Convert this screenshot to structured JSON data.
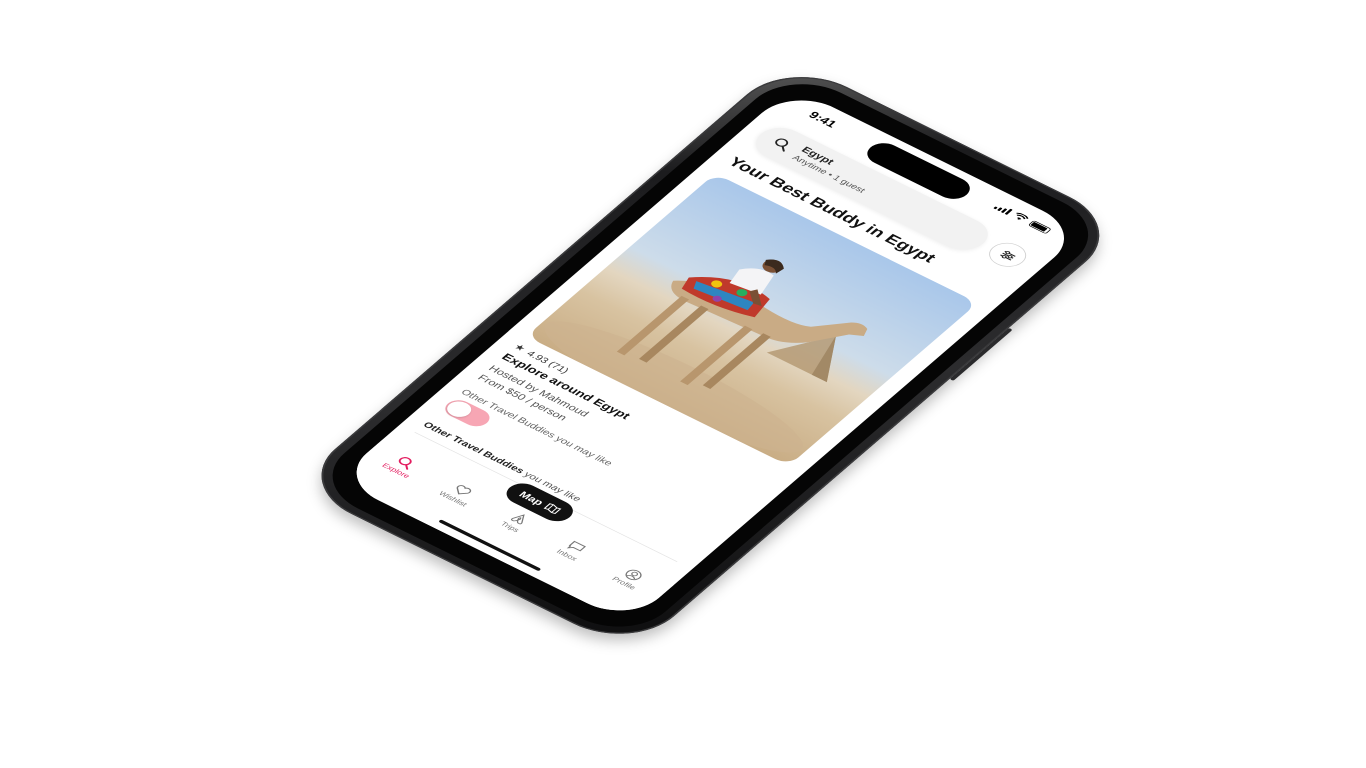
{
  "status_bar": {
    "time": "9:41"
  },
  "search": {
    "location": "Egypt",
    "details": "Anytime • 1 guest"
  },
  "section_title": "Your Best Buddy in Egypt",
  "listing": {
    "rating": "4.93 (71)",
    "title": "Explore around Egypt",
    "host": "Hosted by Mahmoud",
    "price": "From $50 / person"
  },
  "toggle": {
    "label": "Other Travel Buddies you may like",
    "label_bold": "Other Travel Buddies",
    "label_rest": " you may like",
    "on": true
  },
  "map_button": {
    "label": "Map"
  },
  "tabs": [
    {
      "label": "Explore",
      "icon": "search-icon",
      "active": true
    },
    {
      "label": "Wishlist",
      "icon": "heart-icon",
      "active": false
    },
    {
      "label": "Trips",
      "icon": "airbnb-logo-icon",
      "active": false
    },
    {
      "label": "Inbox",
      "icon": "chat-bubble-icon",
      "active": false
    },
    {
      "label": "Profile",
      "icon": "user-circle-icon",
      "active": false
    }
  ],
  "colors": {
    "accent": "#e31c5f",
    "toggle": "#f7a6b4",
    "phone_frame": "#1c1c1e"
  }
}
